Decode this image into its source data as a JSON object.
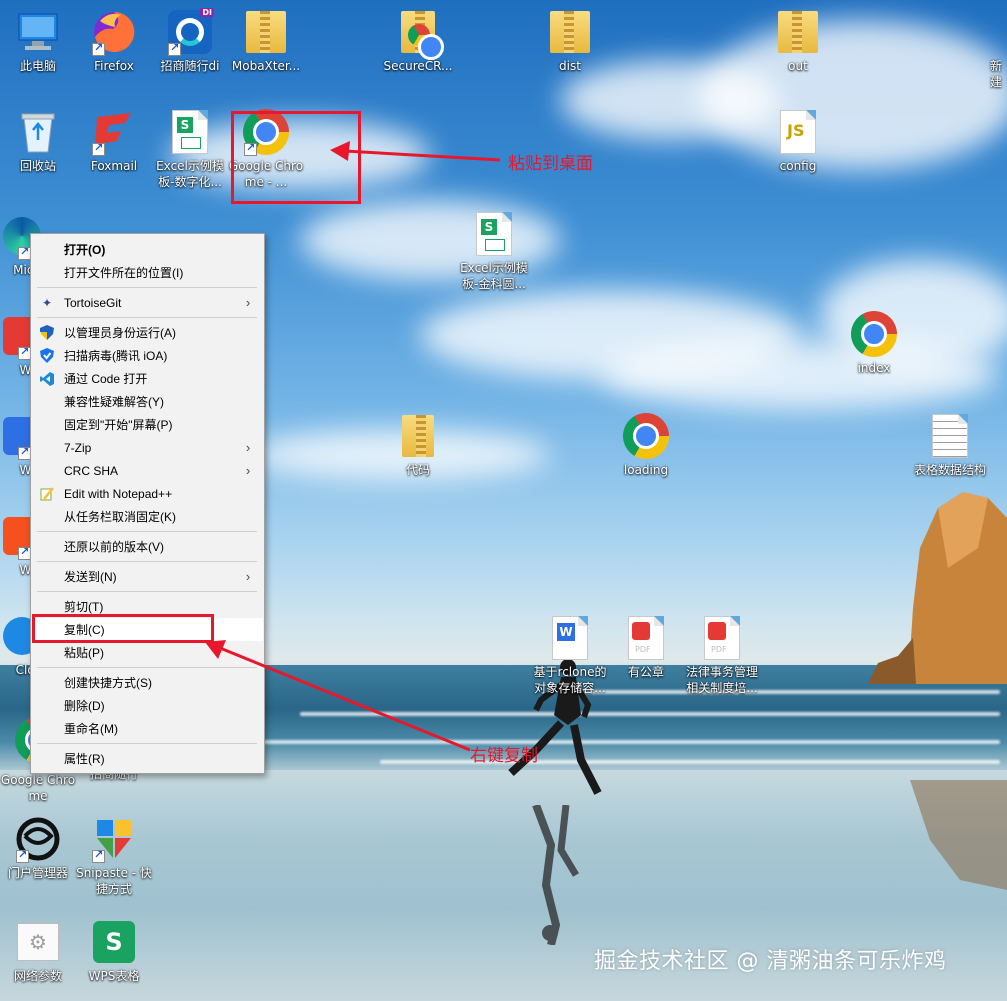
{
  "desktop": {
    "icons": [
      {
        "label": "此电脑"
      },
      {
        "label": "Firefox"
      },
      {
        "label": "招商随行di"
      },
      {
        "label": "MobaXter..."
      },
      {
        "label": "SecureCR..."
      },
      {
        "label": "dist"
      },
      {
        "label": "out"
      },
      {
        "label": "新建"
      },
      {
        "label": "回收站"
      },
      {
        "label": "Foxmail"
      },
      {
        "label": "Excel示例模板-数字化..."
      },
      {
        "label": "Google Chrome - ..."
      },
      {
        "label": "config"
      },
      {
        "label": "Excel示例模板-金科圆..."
      },
      {
        "label": "index"
      },
      {
        "label": "代码"
      },
      {
        "label": "loading"
      },
      {
        "label": "表格数据结构"
      },
      {
        "label": "基于rclone的对象存储容..."
      },
      {
        "label": "有公章"
      },
      {
        "label": "法律事务管理相关制度培..."
      },
      {
        "label": "Google Chrome"
      },
      {
        "label": "招商随行"
      },
      {
        "label": "门户管理器"
      },
      {
        "label": "Snipaste - 快捷方式"
      },
      {
        "label": "网络参数"
      },
      {
        "label": "WPS表格"
      },
      {
        "label": "Mic E"
      },
      {
        "label": "WP"
      },
      {
        "label": "WP"
      },
      {
        "label": "WP"
      },
      {
        "label": "Clou"
      }
    ],
    "icon_badges": {
      "zhaoshang_di": "DI",
      "config_js": "JS"
    }
  },
  "context_menu": {
    "items": [
      {
        "label": "打开(O)",
        "bold": true,
        "icon": "none"
      },
      {
        "label": "打开文件所在的位置(I)",
        "icon": "none"
      },
      {
        "label": "TortoiseGit",
        "icon": "tortoisegit-icon",
        "submenu": true
      },
      {
        "label": "以管理员身份运行(A)",
        "icon": "shield-icon"
      },
      {
        "label": "扫描病毒(腾讯 iOA)",
        "icon": "ioa-shield-icon"
      },
      {
        "label": "通过 Code 打开",
        "icon": "vscode-icon"
      },
      {
        "label": "兼容性疑难解答(Y)",
        "icon": "none"
      },
      {
        "label": "固定到\"开始\"屏幕(P)",
        "icon": "none"
      },
      {
        "label": "7-Zip",
        "icon": "none",
        "submenu": true
      },
      {
        "label": "CRC SHA",
        "icon": "none",
        "submenu": true
      },
      {
        "label": "Edit with Notepad++",
        "icon": "notepadpp-icon"
      },
      {
        "label": "从任务栏取消固定(K)",
        "icon": "none"
      },
      {
        "label": "还原以前的版本(V)",
        "icon": "none"
      },
      {
        "label": "发送到(N)",
        "icon": "none",
        "submenu": true
      },
      {
        "label": "剪切(T)",
        "icon": "none"
      },
      {
        "label": "复制(C)",
        "icon": "none",
        "highlighted": true
      },
      {
        "label": "粘贴(P)",
        "icon": "none"
      },
      {
        "label": "创建快捷方式(S)",
        "icon": "none"
      },
      {
        "label": "删除(D)",
        "icon": "none"
      },
      {
        "label": "重命名(M)",
        "icon": "none"
      },
      {
        "label": "属性(R)",
        "icon": "none"
      }
    ],
    "submenu_arrow": "›"
  },
  "annotations": {
    "paste_to_desktop": "粘贴到桌面",
    "right_click_copy": "右键复制",
    "color": "#e8172b"
  },
  "watermark": "掘金技术社区 @ 清粥油条可乐炸鸡"
}
